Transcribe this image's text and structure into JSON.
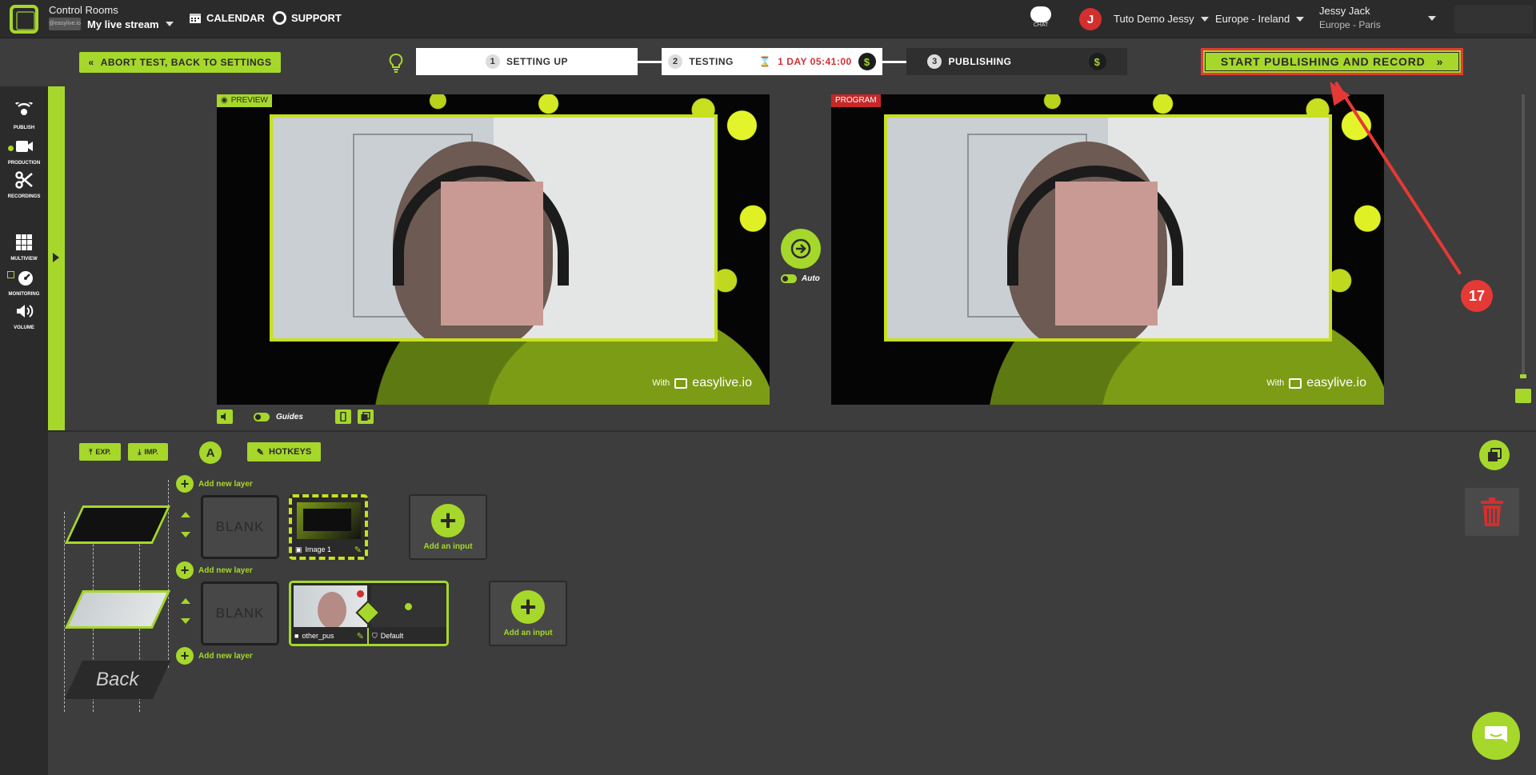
{
  "topbar": {
    "section_title": "Control Rooms",
    "stream_thumb_text": "@easylive.io",
    "stream_name": "My live stream",
    "calendar_label": "CALENDAR",
    "support_label": "SUPPORT",
    "chat_label": "CHAT",
    "avatar_initial": "J",
    "organization": "Tuto Demo Jessy",
    "region": "Europe - Ireland",
    "user_name": "Jessy Jack",
    "user_timezone": "Europe - Paris"
  },
  "toolbar": {
    "abort_label": "ABORT TEST, BACK TO SETTINGS",
    "steps": [
      {
        "num": "1",
        "label": "SETTING UP"
      },
      {
        "num": "2",
        "label": "TESTING",
        "timer": "1 DAY 05:41:00"
      },
      {
        "num": "3",
        "label": "PUBLISHING"
      }
    ],
    "dollar_symbol": "$",
    "start_label": "START PUBLISHING AND RECORD"
  },
  "sidebar": {
    "items": [
      {
        "label": "PUBLISH"
      },
      {
        "label": "PRODUCTION"
      },
      {
        "label": "RECORDINGS"
      },
      {
        "label": "MULTIVIEW"
      },
      {
        "label": "MONITORING"
      },
      {
        "label": "VOLUME"
      }
    ]
  },
  "monitors": {
    "preview_label": "PREVIEW",
    "program_label": "PROGRAM",
    "watermark_with": "With",
    "watermark_brand": "easylive.io",
    "auto_label": "Auto",
    "guides_label": "Guides"
  },
  "layers": {
    "export_label": "EXP.",
    "import_label": "IMP.",
    "a_label": "A",
    "hotkeys_label": "HOTKEYS",
    "add_layer_label": "Add new layer",
    "blank_label": "BLANK",
    "image_input_name": "Image 1",
    "camera_input_name": "other_pus",
    "camera_scene_name": "Default",
    "add_input_label": "Add an input",
    "back_label": "Back"
  },
  "annotation": {
    "step_number": "17"
  },
  "colors": {
    "accent": "#a6d72b",
    "alert": "#e53935",
    "background": "#3d3d3d",
    "topbar": "#2b2b2b"
  }
}
